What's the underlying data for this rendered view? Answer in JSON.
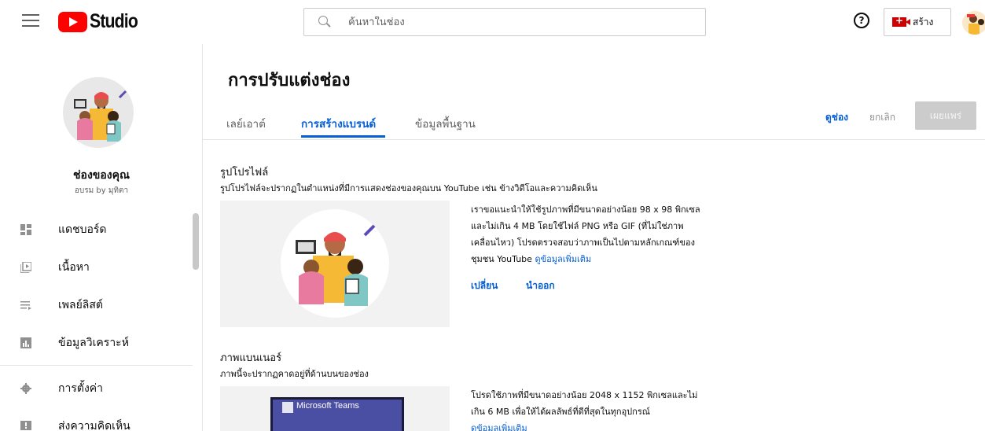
{
  "header": {
    "logo_text": "Studio",
    "search_placeholder": "ค้นหาในช่อง",
    "help_symbol": "?",
    "create_label": "สร้าง"
  },
  "sidebar": {
    "channel_name": "ช่องของคุณ",
    "channel_sub": "อบรม by มุทิตา",
    "items": [
      {
        "label": "แดชบอร์ด",
        "icon": "dashboard-icon"
      },
      {
        "label": "เนื้อหา",
        "icon": "content-icon"
      },
      {
        "label": "เพลย์ลิสต์",
        "icon": "playlist-icon"
      },
      {
        "label": "ข้อมูลวิเคราะห์",
        "icon": "analytics-icon"
      },
      {
        "label": "การตั้งค่า",
        "icon": "gear-icon"
      },
      {
        "label": "ส่งความคิดเห็น",
        "icon": "feedback-icon"
      }
    ]
  },
  "main": {
    "title": "การปรับแต่งช่อง",
    "tabs": [
      {
        "label": "เลย์เอาต์"
      },
      {
        "label": "การสร้างแบรนด์"
      },
      {
        "label": "ข้อมูลพื้นฐาน"
      }
    ],
    "actions": {
      "view": "ดูช่อง",
      "cancel": "ยกเลิก",
      "publish": "เผยแพร่"
    },
    "profile": {
      "title": "รูปโปรไฟล์",
      "desc": "รูปโปรไฟล์จะปรากฏในตำแหน่งที่มีการแสดงช่องของคุณบน YouTube เช่น ข้างวิดีโอและความคิดเห็น",
      "help_lines": [
        "เราขอแนะนำให้ใช้รูปภาพที่มีขนาดอย่างน้อย 98 x 98 พิกเซล",
        "และไม่เกิน 4 MB โดยใช้ไฟล์ PNG หรือ GIF (ที่ไม่ใช่ภาพ",
        "เคลื่อนไหว) โปรดตรวจสอบว่าภาพเป็นไปตามหลักเกณฑ์ของ",
        "ชุมชน YouTube"
      ],
      "learn_more": "ดูข้อมูลเพิ่มเติม",
      "change": "เปลี่ยน",
      "remove": "นำออก"
    },
    "banner": {
      "title": "ภาพแบนเนอร์",
      "desc": "ภาพนี้จะปรากฏคาดอยู่ที่ด้านบนของช่อง",
      "preview_text": "Microsoft Teams",
      "help_lines": [
        "โปรดใช้ภาพที่มีขนาดอย่างน้อย 2048 x 1152 พิกเซลและไม่",
        "เกิน 6 MB เพื่อให้ได้ผลลัพธ์ที่ดีที่สุดในทุกอุปกรณ์"
      ],
      "learn_more": "ดูข้อมูลเพิ่มเติม"
    }
  }
}
